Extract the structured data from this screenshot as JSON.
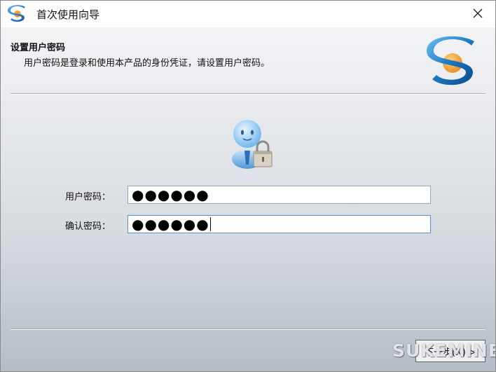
{
  "window": {
    "title": "首次使用向导"
  },
  "header": {
    "title": "设置用户密码",
    "description": "用户密码是登录和使用本产品的身份凭证，请设置用户密码。"
  },
  "form": {
    "password_label": "用户密码：",
    "password_value": "●●●●●●",
    "confirm_label": "确认密码：",
    "confirm_value": "●●●●●●"
  },
  "footer": {
    "next_label": "下一步(N) >"
  },
  "watermark": "SUKEMINE",
  "colors": {
    "brand_blue": "#1f6fb5",
    "brand_orange": "#f2a33a"
  }
}
